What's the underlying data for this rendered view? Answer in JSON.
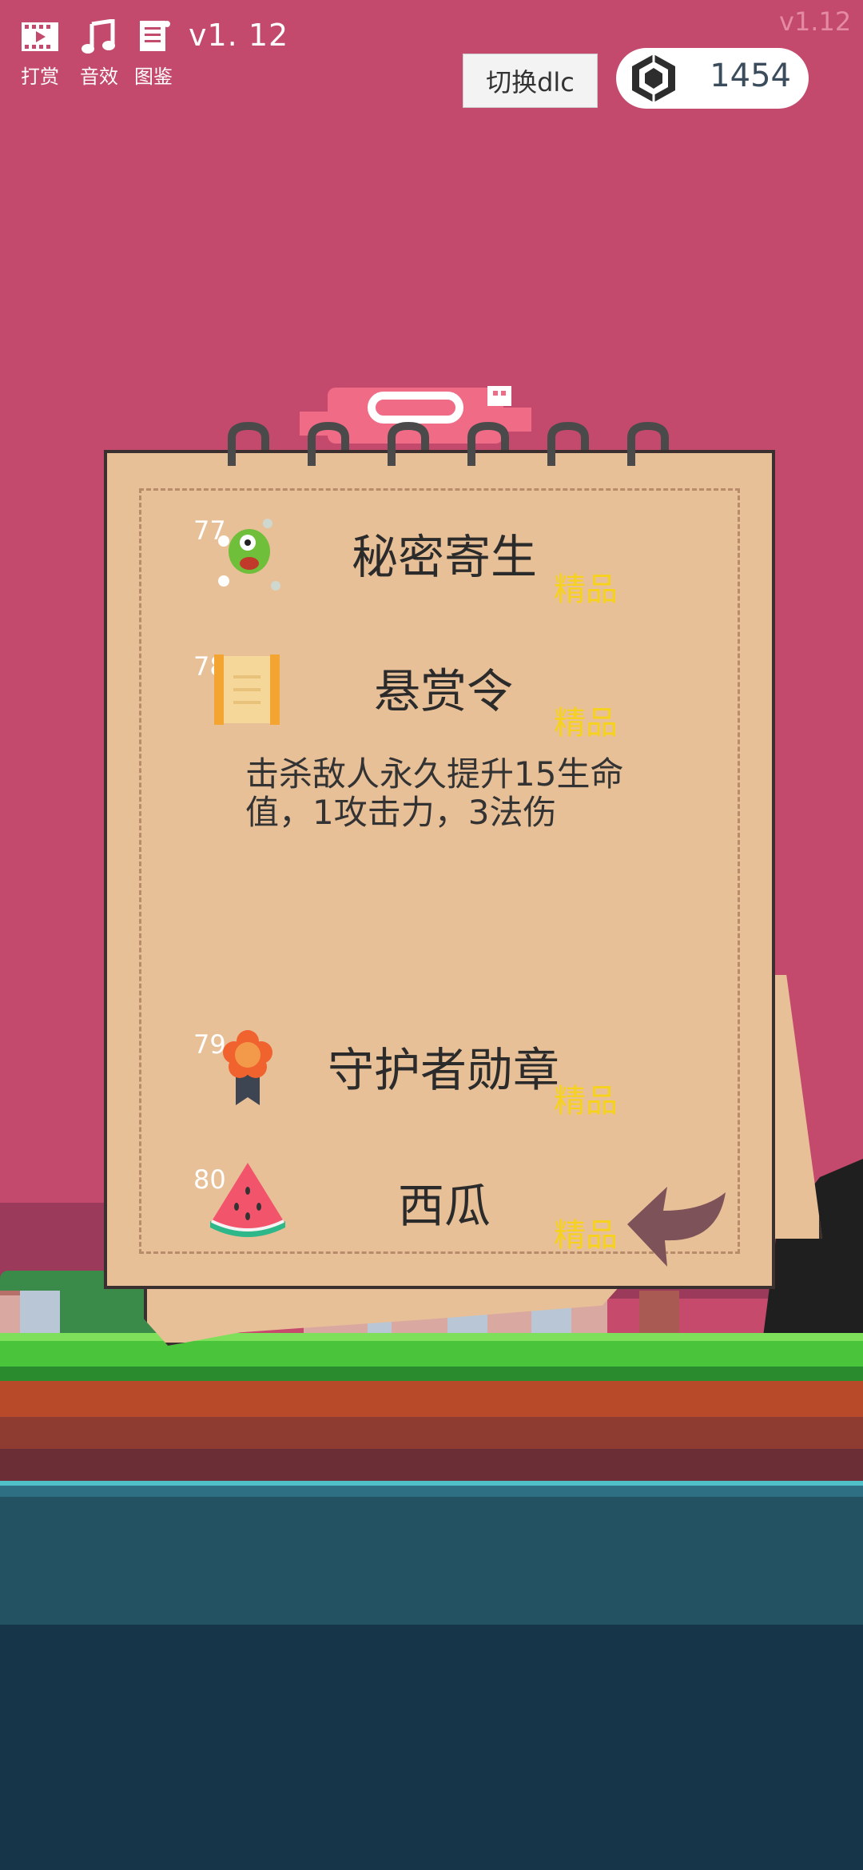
{
  "hud": {
    "reward_label": "打赏",
    "sound_label": "音效",
    "codex_label": "图鉴",
    "version": "v1. 12",
    "version_corner": "v1.12",
    "dlc_button": "切换dlc",
    "gem_count": "1454"
  },
  "items": [
    {
      "number": "77",
      "name": "秘密寄生",
      "badge": "精品",
      "icon": "parasite-icon"
    },
    {
      "number": "78",
      "name": "悬赏令",
      "badge": "精品",
      "icon": "scroll-icon",
      "description": "击杀敌人永久提升15生命值，1攻击力，3法伤"
    },
    {
      "number": "79",
      "name": "守护者勋章",
      "badge": "精品",
      "icon": "medal-icon"
    },
    {
      "number": "80",
      "name": "西瓜",
      "badge": "精品",
      "icon": "watermelon-icon"
    }
  ],
  "colors": {
    "badge": "#f7d21c",
    "parchment": "#e8c098",
    "sky": "#c44a6d"
  }
}
